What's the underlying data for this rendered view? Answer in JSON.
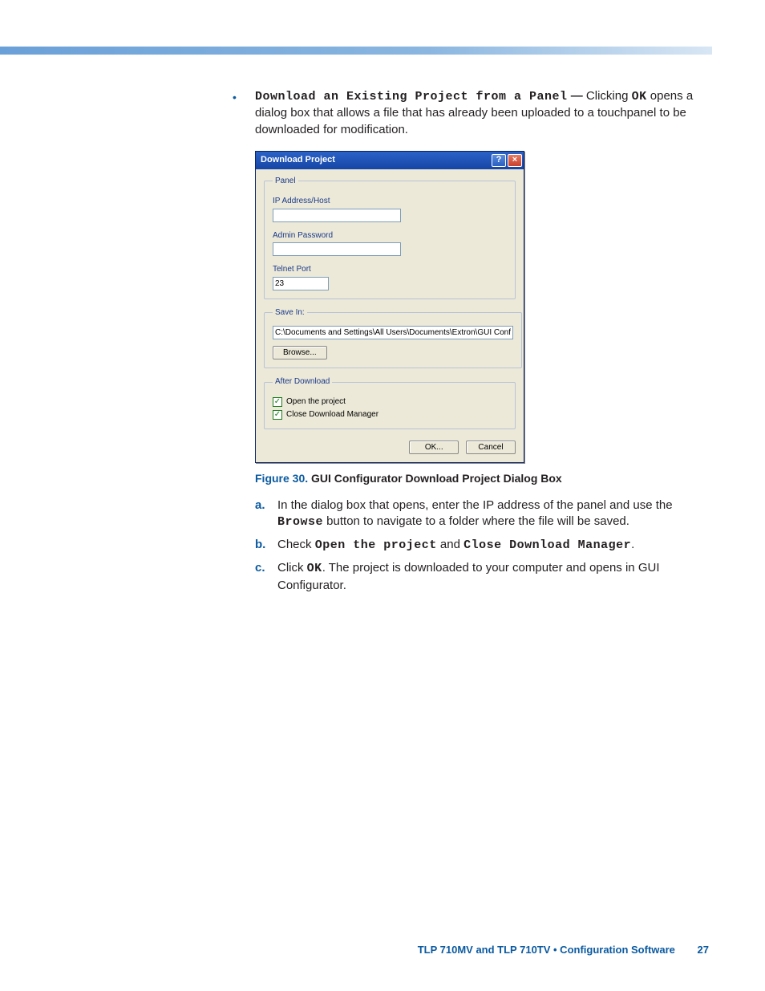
{
  "intro": {
    "bullet_title": "Download an Existing Project from a Panel",
    "dash": " — ",
    "pre": "Clicking ",
    "ok": "OK",
    "post": " opens a dialog box that allows a file that has already been uploaded to a touchpanel to be downloaded for modification."
  },
  "dialog": {
    "title": "Download Project",
    "panel_legend": "Panel",
    "ip_label": "IP Address/Host",
    "ip_value": "",
    "admin_label": "Admin Password",
    "admin_value": "",
    "telnet_label": "Telnet Port",
    "telnet_value": "23",
    "savein_legend": "Save In:",
    "savein_value": "C:\\Documents and Settings\\All Users\\Documents\\Extron\\GUI Configurator",
    "browse_label": "Browse...",
    "after_legend": "After Download",
    "chk1_label": "Open the project",
    "chk2_label": "Close Download Manager",
    "ok_label": "OK...",
    "cancel_label": "Cancel"
  },
  "caption": {
    "fig": "Figure 30.",
    "text": "GUI Configurator Download Project Dialog Box"
  },
  "steps": {
    "a": {
      "lab": "a.",
      "t1": "In the dialog box that opens, enter the IP address of the panel and use the ",
      "browse": "Browse",
      "t2": " button to navigate to a folder where the file will be saved."
    },
    "b": {
      "lab": "b.",
      "t1": "Check ",
      "m1": "Open the project",
      "t2": " and ",
      "m2": "Close Download Manager",
      "t3": "."
    },
    "c": {
      "lab": "c.",
      "t1": "Click ",
      "ok": "OK",
      "t2": ". The project is downloaded to your computer and opens in GUI Configurator."
    }
  },
  "footer": {
    "text": "TLP 710MV and TLP 710TV • Configuration Software",
    "page": "27"
  }
}
